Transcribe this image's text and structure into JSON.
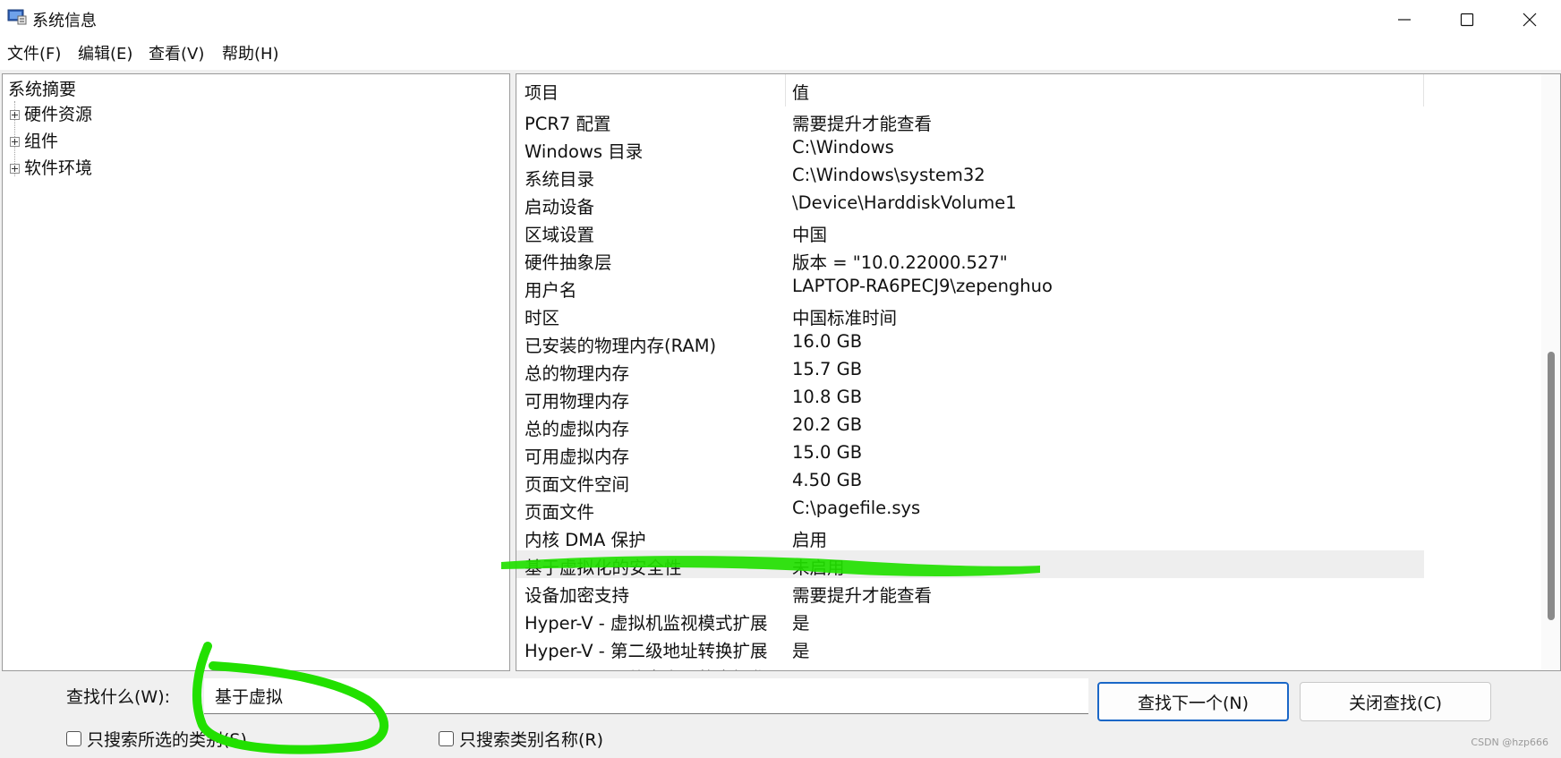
{
  "window": {
    "title": "系统信息"
  },
  "menu": [
    "文件(F)",
    "编辑(E)",
    "查看(V)",
    "帮助(H)"
  ],
  "tree": {
    "root": "系统摘要",
    "children": [
      "硬件资源",
      "组件",
      "软件环境"
    ]
  },
  "list": {
    "headers": {
      "item": "项目",
      "value": "值"
    },
    "selected_item": "基于虚拟化的安全性",
    "rows": [
      {
        "item": "PCR7 配置",
        "value": "需要提升才能查看"
      },
      {
        "item": "Windows 目录",
        "value": "C:\\Windows"
      },
      {
        "item": "系统目录",
        "value": "C:\\Windows\\system32"
      },
      {
        "item": "启动设备",
        "value": "\\Device\\HarddiskVolume1"
      },
      {
        "item": "区域设置",
        "value": "中国"
      },
      {
        "item": "硬件抽象层",
        "value": "版本 = \"10.0.22000.527\""
      },
      {
        "item": "用户名",
        "value": "LAPTOP-RA6PECJ9\\zepenghuo"
      },
      {
        "item": "时区",
        "value": "中国标准时间"
      },
      {
        "item": "已安装的物理内存(RAM)",
        "value": "16.0 GB"
      },
      {
        "item": "总的物理内存",
        "value": "15.7 GB"
      },
      {
        "item": "可用物理内存",
        "value": "10.8 GB"
      },
      {
        "item": "总的虚拟内存",
        "value": "20.2 GB"
      },
      {
        "item": "可用虚拟内存",
        "value": "15.0 GB"
      },
      {
        "item": "页面文件空间",
        "value": "4.50 GB"
      },
      {
        "item": "页面文件",
        "value": "C:\\pagefile.sys"
      },
      {
        "item": "内核 DMA 保护",
        "value": "启用"
      },
      {
        "item": "基于虚拟化的安全性",
        "value": "未启用"
      },
      {
        "item": "设备加密支持",
        "value": "需要提升才能查看"
      },
      {
        "item": "Hyper-V - 虚拟机监视模式扩展",
        "value": "是"
      },
      {
        "item": "Hyper-V - 第二级地址转换扩展",
        "value": "是"
      },
      {
        "item": "Hyper-V - 固件中启用的虚拟化",
        "value": "是"
      }
    ]
  },
  "find": {
    "label": "查找什么(W):",
    "value": "基于虚拟",
    "find_next": "查找下一个(N)",
    "close_find": "关闭查找(C)",
    "option_selected_category": "只搜索所选的类别(S)",
    "option_category_names": "只搜索类别名称(R)"
  },
  "watermark": "CSDN @hzp666",
  "colors": {
    "highlight_marker": "#22e000",
    "primary_button_border": "#1a67c7"
  }
}
